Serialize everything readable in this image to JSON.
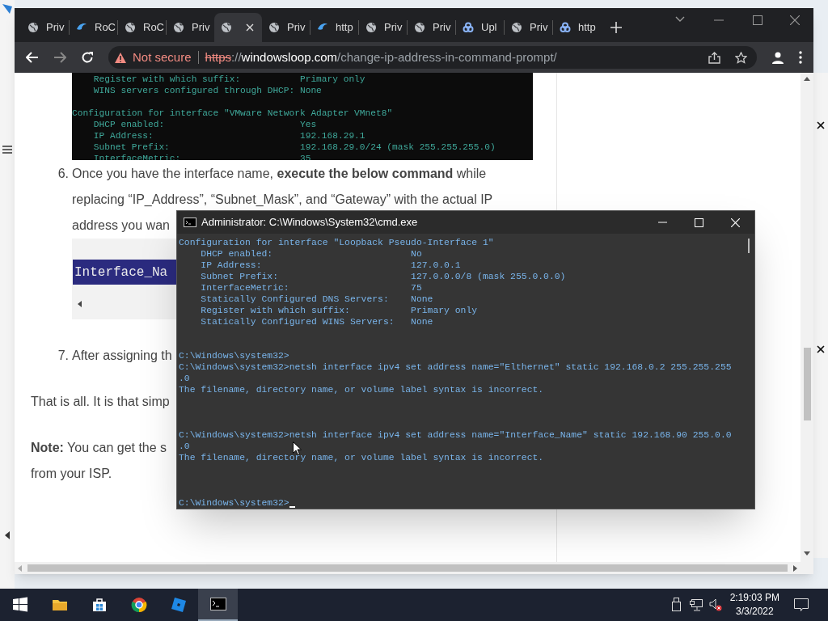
{
  "browser": {
    "tabs": [
      {
        "label": "Priv",
        "kind": "globe",
        "selected": false
      },
      {
        "label": "RoC",
        "kind": "swoosh",
        "selected": false
      },
      {
        "label": "RoC",
        "kind": "globe",
        "selected": false
      },
      {
        "label": "Priv",
        "kind": "globe",
        "selected": false
      },
      {
        "kind": "globe",
        "selected": true
      },
      {
        "label": "Priv",
        "kind": "globe",
        "selected": false
      },
      {
        "label": "http",
        "kind": "swoosh",
        "selected": false
      },
      {
        "label": "Priv",
        "kind": "globe",
        "selected": false
      },
      {
        "label": "Priv",
        "kind": "globe",
        "selected": false
      },
      {
        "label": "Upl",
        "kind": "cloud",
        "selected": false
      },
      {
        "label": "Priv",
        "kind": "globe",
        "selected": false
      },
      {
        "label": "http",
        "kind": "cloud",
        "selected": false
      }
    ],
    "address_bar": {
      "security": "Not secure",
      "scheme": "https",
      "separator": "://",
      "host": "windowsloop.com",
      "path": "/change-ip-address-in-command-prompt/"
    }
  },
  "article": {
    "blocks": [
      {
        "kind": "terminal",
        "lines": [
          {
            "kind": "field",
            "label": "Register with which suffix:",
            "value": "Primary only"
          },
          {
            "kind": "field",
            "label": "WINS servers configured through DHCP:",
            "value": "None"
          },
          {
            "kind": "blank"
          },
          {
            "kind": "text",
            "text": "Configuration for interface \"VMware Network Adapter VMnet8\""
          },
          {
            "kind": "field",
            "label": "DHCP enabled:",
            "value": "Yes"
          },
          {
            "kind": "field",
            "label": "IP Address:",
            "value": "192.168.29.1"
          },
          {
            "kind": "field",
            "label": "Subnet Prefix:",
            "value": "192.168.29.0/24 (mask 255.255.255.0)"
          },
          {
            "kind": "field",
            "label": "InterfaceMetric:",
            "value": "35"
          }
        ]
      },
      {
        "kind": "step",
        "number": "6.",
        "lines": [
          "Once you have the interface name, **execute the below command** while",
          "replacing “IP_Address”, “Subnet_Mask”, and “Gateway” with the actual IP",
          "address you wan"
        ]
      },
      {
        "kind": "code",
        "text": "Interface_Na"
      },
      {
        "kind": "step",
        "number": "7.",
        "lines": [
          "After assigning th"
        ]
      },
      {
        "kind": "paragraph",
        "lines": [
          "That is all. It is that simp"
        ]
      },
      {
        "kind": "paragraph",
        "lines": [
          "**Note:** You can get the s",
          "from your ISP."
        ]
      }
    ]
  },
  "cmd_window": {
    "title": "Administrator: C:\\Windows\\System32\\cmd.exe",
    "lines": [
      {
        "kind": "text",
        "text": "Configuration for interface \"Loopback Pseudo-Interface 1\""
      },
      {
        "kind": "field",
        "label": "DHCP enabled:",
        "value": "No"
      },
      {
        "kind": "field",
        "label": "IP Address:",
        "value": "127.0.0.1"
      },
      {
        "kind": "field",
        "label": "Subnet Prefix:",
        "value": "127.0.0.0/8 (mask 255.0.0.0)"
      },
      {
        "kind": "field",
        "label": "InterfaceMetric:",
        "value": "75"
      },
      {
        "kind": "field",
        "label": "Statically Configured DNS Servers:",
        "value": "None"
      },
      {
        "kind": "field",
        "label": "Register with which suffix:",
        "value": "Primary only"
      },
      {
        "kind": "field",
        "label": "Statically Configured WINS Servers:",
        "value": "None"
      },
      {
        "kind": "blank"
      },
      {
        "kind": "blank"
      },
      {
        "kind": "text",
        "text": "C:\\Windows\\system32>"
      },
      {
        "kind": "text",
        "text": "C:\\Windows\\system32>netsh interface ipv4 set address name=\"Elthernet\" static 192.168.0.2 255.255.255"
      },
      {
        "kind": "text",
        "text": ".0"
      },
      {
        "kind": "text",
        "text": "The filename, directory name, or volume label syntax is incorrect."
      },
      {
        "kind": "blank"
      },
      {
        "kind": "blank"
      },
      {
        "kind": "blank"
      },
      {
        "kind": "text",
        "text": "C:\\Windows\\system32>netsh interface ipv4 set address name=\"Interface_Name\" static 192.168.90 255.0.0"
      },
      {
        "kind": "text",
        "text": ".0"
      },
      {
        "kind": "text",
        "text": "The filename, directory name, or volume label syntax is incorrect."
      },
      {
        "kind": "blank"
      },
      {
        "kind": "blank"
      },
      {
        "kind": "blank"
      },
      {
        "kind": "prompt",
        "text": "C:\\Windows\\system32>"
      }
    ]
  },
  "taskbar": {
    "apps": [
      {
        "kind": "start",
        "active": false
      },
      {
        "kind": "folder",
        "active": false
      },
      {
        "kind": "store",
        "active": false
      },
      {
        "kind": "chrome",
        "active": false
      },
      {
        "kind": "roblox",
        "active": false
      },
      {
        "kind": "terminal",
        "active": true
      }
    ],
    "clock": {
      "time": "2:19:03 PM",
      "date": "3/3/2022"
    }
  }
}
